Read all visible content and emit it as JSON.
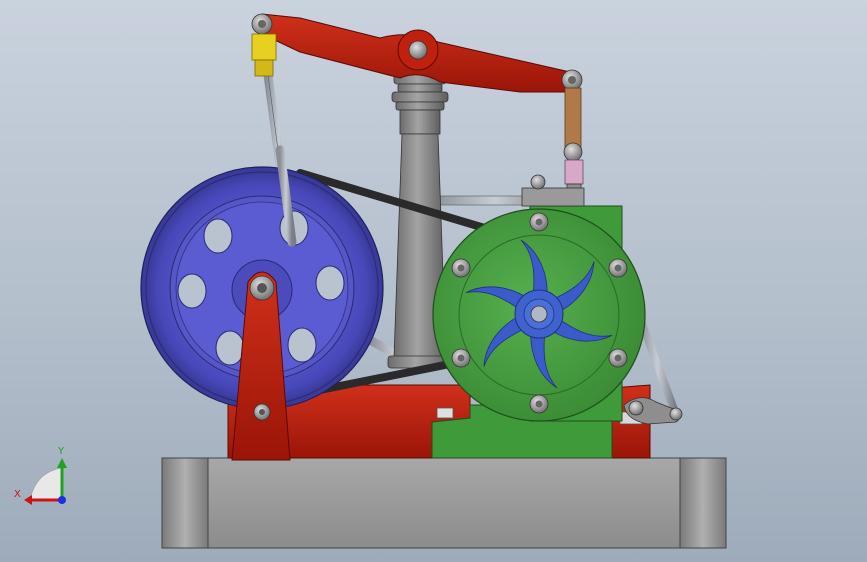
{
  "view": {
    "background_top": "#c9d2dd",
    "background_bottom": "#9eabba"
  },
  "parts": [
    {
      "name": "base-block",
      "color": "#9a9a9a"
    },
    {
      "name": "red-frame",
      "color": "#c0210f"
    },
    {
      "name": "red-walking-beam",
      "color": "#c0210f"
    },
    {
      "name": "grey-column",
      "color": "#8e8e8e"
    },
    {
      "name": "blue-flywheel",
      "color": "#5a5ad0"
    },
    {
      "name": "green-pump-housing",
      "color": "#3f9a3a"
    },
    {
      "name": "yellow-connector",
      "color": "#e8d020"
    },
    {
      "name": "bronze-rod",
      "color": "#b07a48"
    },
    {
      "name": "black-belt",
      "color": "#2a2a2a"
    }
  ],
  "triad": {
    "x_label": "X",
    "y_label": "Y",
    "x_color": "#c81414",
    "y_color": "#1fa21f",
    "z_color": "#1b2ee0"
  }
}
